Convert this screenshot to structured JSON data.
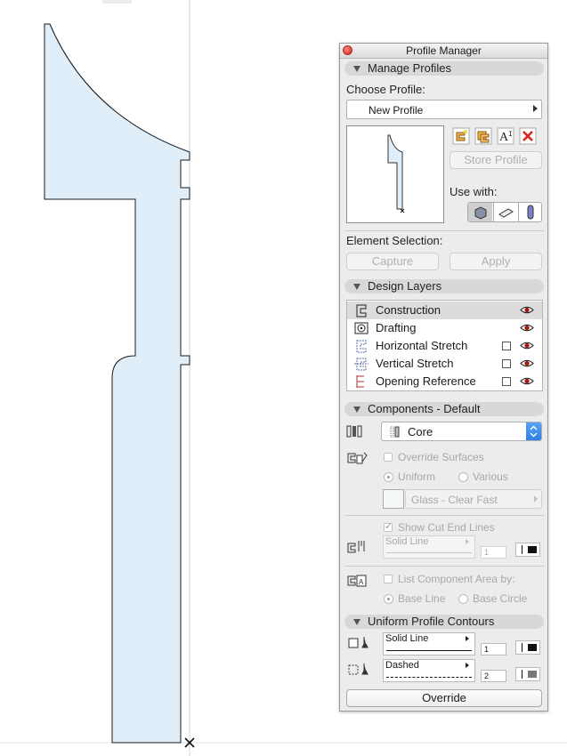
{
  "window": {
    "title": "Profile Manager"
  },
  "manage_profiles": {
    "section_label": "Manage Profiles",
    "choose_label": "Choose Profile:",
    "selected_profile": "New Profile",
    "store_button": "Store Profile",
    "use_with_label": "Use with:",
    "tool_icons": [
      "new-profile-icon",
      "duplicate-profile-icon",
      "rename-profile-icon",
      "delete-profile-icon"
    ],
    "use_with_icons": [
      "wall-icon",
      "beam-icon",
      "column-icon"
    ]
  },
  "element_selection": {
    "label": "Element Selection:",
    "capture_button": "Capture",
    "apply_button": "Apply"
  },
  "design_layers": {
    "section_label": "Design Layers",
    "layers": [
      {
        "name": "Construction",
        "has_checkbox": false,
        "selected": true
      },
      {
        "name": "Drafting",
        "has_checkbox": false,
        "selected": false
      },
      {
        "name": "Horizontal Stretch",
        "has_checkbox": true,
        "selected": false
      },
      {
        "name": "Vertical Stretch",
        "has_checkbox": true,
        "selected": false
      },
      {
        "name": "Opening Reference",
        "has_checkbox": true,
        "selected": false
      }
    ]
  },
  "components": {
    "section_label": "Components - Default",
    "component_value": "Core",
    "override_surfaces_label": "Override Surfaces",
    "uniform_label": "Uniform",
    "various_label": "Various",
    "surface_value": "Glass - Clear Fast",
    "show_cut_end_lines_label": "Show Cut End Lines",
    "cut_line_type": "Solid Line",
    "cut_pen_number": "1",
    "list_area_label": "List Component Area by:",
    "base_line_label": "Base Line",
    "base_circle_label": "Base Circle"
  },
  "contours": {
    "section_label": "Uniform Profile Contours",
    "line1_type": "Solid Line",
    "line1_pen": "1",
    "line2_type": "Dashed",
    "line2_pen": "2",
    "override_button": "Override"
  },
  "colors": {
    "profile_fill": "#dfeef9",
    "accent_blue": "#2f7fe6",
    "delete_red": "#d9261c"
  }
}
